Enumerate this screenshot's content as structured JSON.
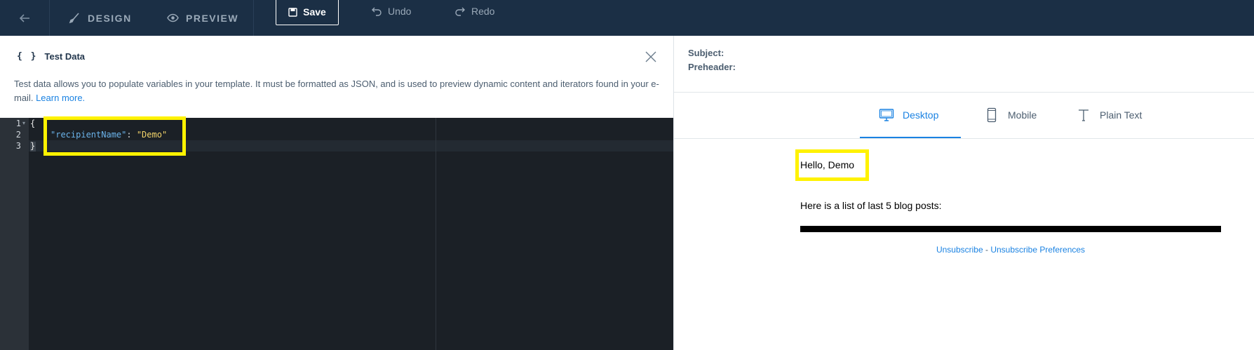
{
  "toolbar": {
    "back_icon": "arrow-left-icon",
    "design_label": "DESIGN",
    "preview_label": "PREVIEW",
    "save_label": "Save",
    "undo_label": "Undo",
    "redo_label": "Redo"
  },
  "test_data_panel": {
    "title_icon": "{ }",
    "title": "Test Data",
    "description": "Test data allows you to populate variables in your template. It must be formatted as JSON, and is used to preview dynamic content and iterators found in your e-mail.",
    "learn_more": "Learn more."
  },
  "editor": {
    "line_numbers": [
      "1",
      "2",
      "3"
    ],
    "lines": {
      "open": "{",
      "key": "\"recipientName\"",
      "colon": ": ",
      "value": "\"Demo\"",
      "close": "}"
    }
  },
  "preview_panel": {
    "subject_label": "Subject:",
    "preheader_label": "Preheader:",
    "tabs": {
      "desktop": "Desktop",
      "mobile": "Mobile",
      "plain_text": "Plain Text"
    },
    "active_tab": "Desktop",
    "email": {
      "greeting": "Hello, Demo",
      "intro": "Here is a list of last 5 blog posts:",
      "unsubscribe": "Unsubscribe",
      "separator": " - ",
      "unsubscribe_preferences": "Unsubscribe Preferences"
    }
  },
  "colors": {
    "topbar_bg": "#1b2f45",
    "accent": "#1a82e2",
    "highlight": "#fff200",
    "editor_bg": "#1b2026"
  }
}
